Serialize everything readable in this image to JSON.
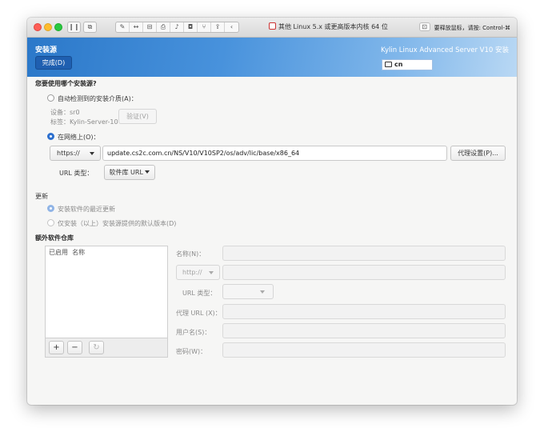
{
  "toolbar": {
    "vm_title": "其他 Linux 5.x 或更高版本内核 64 位",
    "release_hint": "要释放鼠标，请按: Control-⌘"
  },
  "header": {
    "title": "安装源",
    "done_label": "完成(D)",
    "product": "Kylin Linux Advanced Server V10 安装",
    "keyboard_layout": "cn"
  },
  "source": {
    "question": "您要使用哪个安装源?",
    "auto_detect_label": "自动检测到的安装介质(A)：",
    "device_label": "设备：sr0",
    "tag_label": "标签：Kylin-Server-10",
    "verify_label": "验证(V)",
    "network_label": "在网络上(O)：",
    "protocol": "https://",
    "url": "update.cs2c.com.cn/NS/V10/V10SP2/os/adv/lic/base/x86_64",
    "proxy_label": "代理设置(P)...",
    "url_type_label": "URL 类型：",
    "url_type_value": "软件库 URL"
  },
  "updates": {
    "title": "更新",
    "latest_label": "安装软件的最近更新",
    "default_label": "仅安装（以上）安装源提供的默认版本(D)"
  },
  "repos": {
    "title": "额外软件仓库",
    "col_enabled": "已启用",
    "col_name": "名称",
    "add": "+",
    "remove": "−",
    "refresh": "↻",
    "name_label": "名称(N)：",
    "protocol": "http://",
    "url_type_label": "URL 类型：",
    "proxy_url_label": "代理 URL (X)：",
    "username_label": "用户名(S)：",
    "password_label": "密码(W)："
  }
}
